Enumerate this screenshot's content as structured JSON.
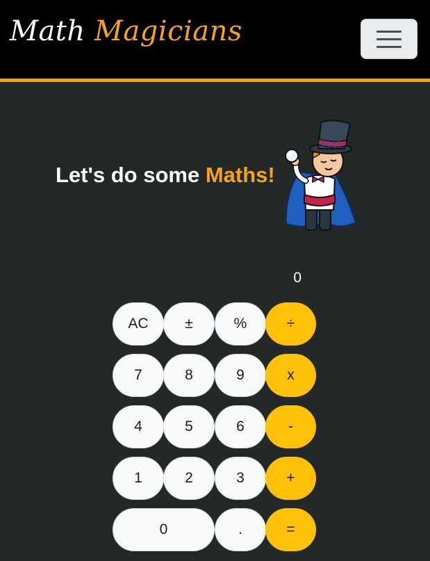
{
  "navbar": {
    "brand_word1": "Math",
    "brand_word2": "Magicians",
    "toggler_icon": "hamburger-menu-icon"
  },
  "hero": {
    "text_prefix": "Let's do some ",
    "text_accent": "Maths!",
    "illustration": "magician-illustration"
  },
  "calculator": {
    "display": "0",
    "keys": {
      "ac": "AC",
      "plusminus": "±",
      "percent": "%",
      "divide": "÷",
      "seven": "7",
      "eight": "8",
      "nine": "9",
      "multiply": "x",
      "four": "4",
      "five": "5",
      "six": "6",
      "minus": "-",
      "one": "1",
      "two": "2",
      "three": "3",
      "plus": "+",
      "zero": "0",
      "dot": ".",
      "equals": "="
    }
  },
  "colors": {
    "background": "#232829",
    "navbar": "#000000",
    "accent": "#f7a21b",
    "operator": "#ffc107",
    "key": "#f8f9fa"
  }
}
